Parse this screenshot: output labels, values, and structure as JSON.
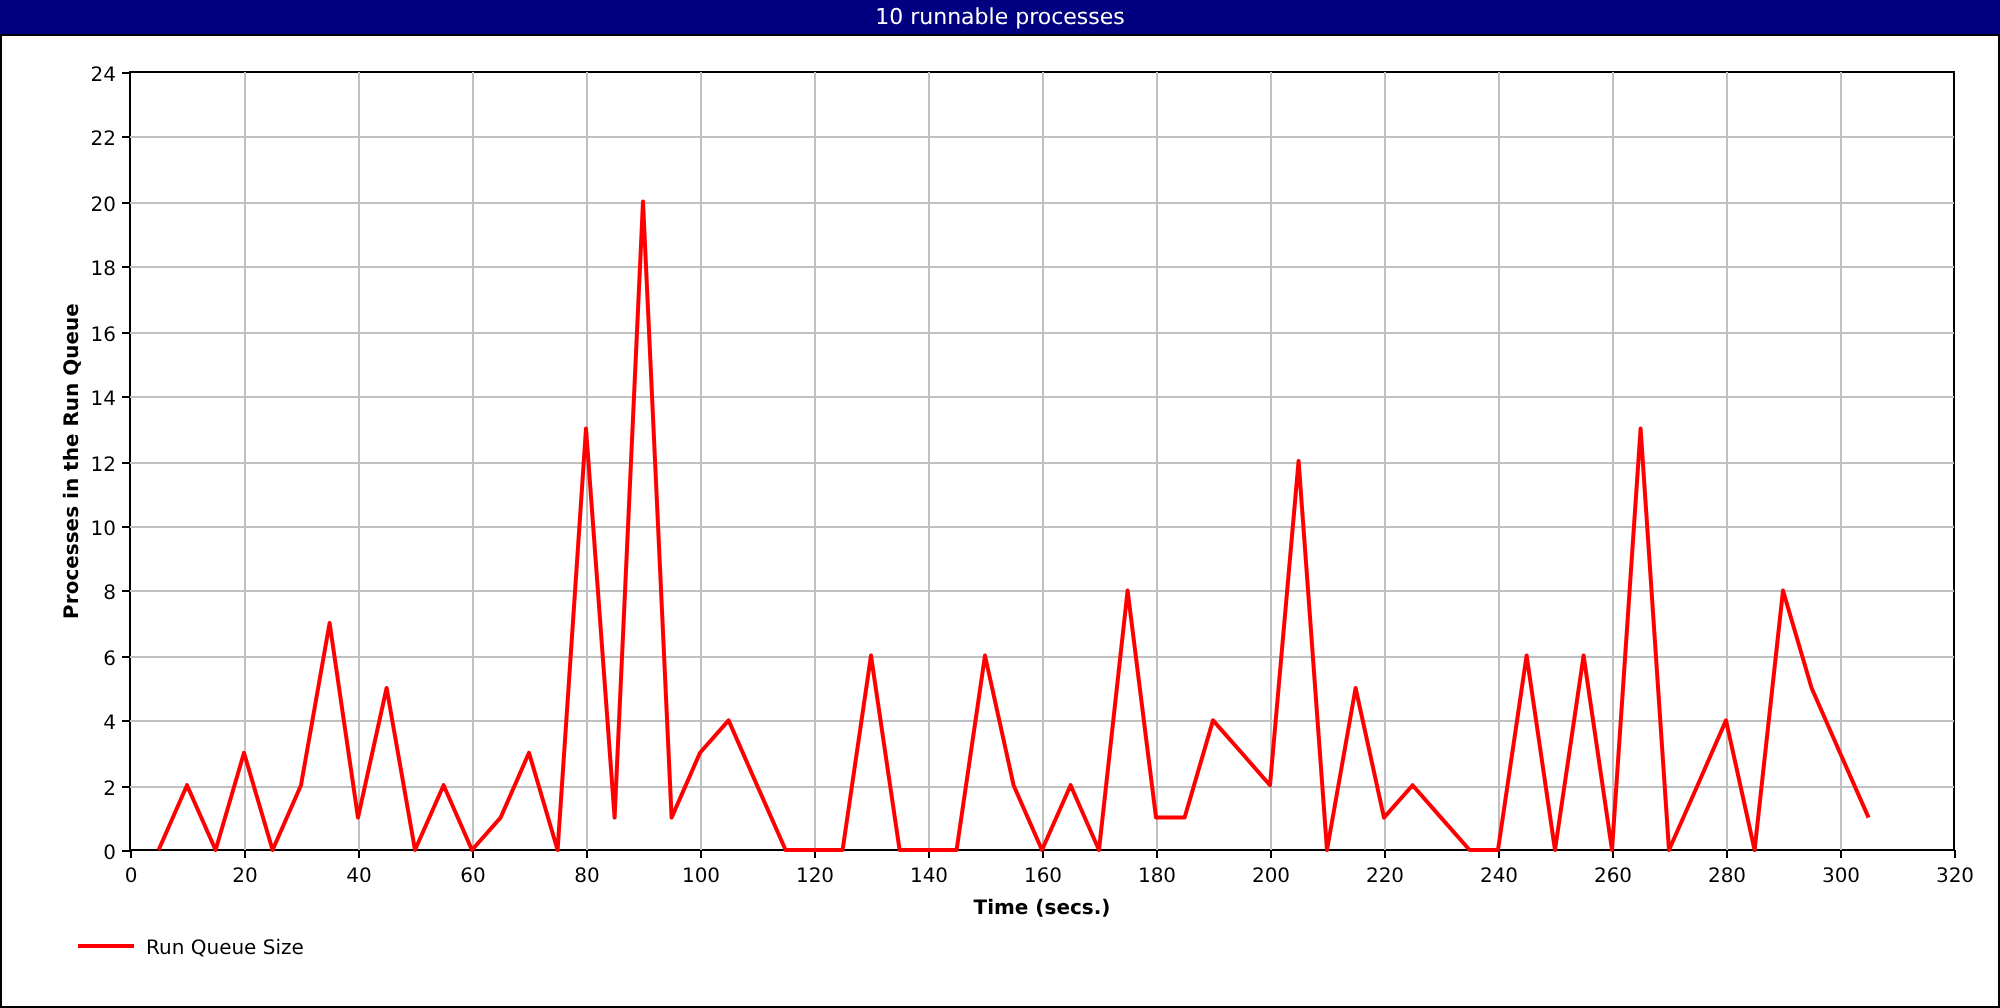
{
  "window": {
    "title": "10 runnable processes"
  },
  "chart": {
    "chart_data": {
      "type": "line",
      "xlabel": "Time (secs.)",
      "ylabel": "Processes in the Run Queue",
      "x": [
        5,
        10,
        15,
        20,
        25,
        30,
        35,
        40,
        45,
        50,
        55,
        60,
        65,
        70,
        75,
        80,
        85,
        90,
        95,
        100,
        105,
        110,
        115,
        120,
        125,
        130,
        135,
        140,
        145,
        150,
        155,
        160,
        165,
        170,
        175,
        180,
        185,
        190,
        195,
        200,
        205,
        210,
        215,
        220,
        225,
        230,
        235,
        240,
        245,
        250,
        255,
        260,
        265,
        270,
        275,
        280,
        285,
        290,
        295,
        300,
        305
      ],
      "series": [
        {
          "name": "Run Queue Size",
          "color": "#ff0000",
          "values": [
            0,
            2,
            0,
            3,
            0,
            2,
            7,
            1,
            5,
            0,
            2,
            0,
            1,
            3,
            0,
            13,
            1,
            20,
            1,
            3,
            4,
            2,
            0,
            0,
            0,
            6,
            0,
            0,
            0,
            6,
            2,
            0,
            2,
            0,
            8,
            1,
            1,
            4,
            3,
            2,
            12,
            0,
            5,
            1,
            2,
            1,
            0,
            0,
            6,
            0,
            6,
            0,
            13,
            0,
            2,
            4,
            0,
            8,
            5,
            3,
            1
          ]
        }
      ],
      "xlim": [
        0,
        320
      ],
      "ylim": [
        0,
        24
      ],
      "xticks": [
        0,
        20,
        40,
        60,
        80,
        100,
        120,
        140,
        160,
        180,
        200,
        220,
        240,
        260,
        280,
        300,
        320
      ],
      "yticks": [
        0,
        2,
        4,
        6,
        8,
        10,
        12,
        14,
        16,
        18,
        20,
        22,
        24
      ],
      "grid": true
    }
  }
}
